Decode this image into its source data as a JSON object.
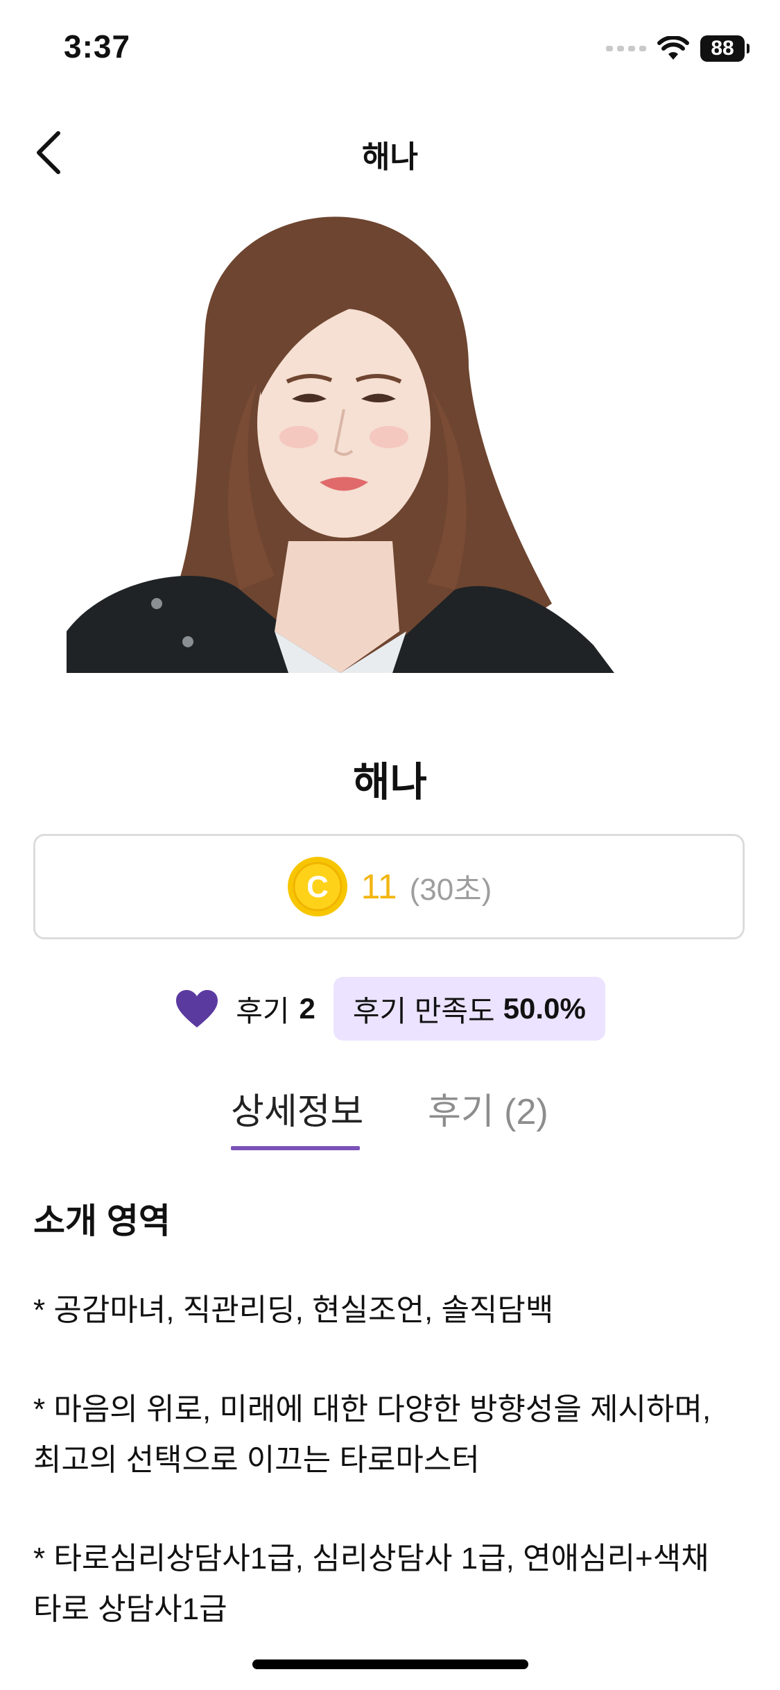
{
  "status_bar": {
    "time": "3:37",
    "battery": "88"
  },
  "nav": {
    "title": "해나"
  },
  "profile": {
    "name": "해나",
    "photo_icon": "profile-photo"
  },
  "price": {
    "coin_icon_letter": "C",
    "amount": "11",
    "unit": "(30초)",
    "coin_color": "#f2b511"
  },
  "stats": {
    "review_label": "후기",
    "review_count": "2",
    "satisfaction_label": "후기 만족도",
    "satisfaction_value": "50.0%",
    "heart_color": "#5b3aa0"
  },
  "tabs": [
    {
      "label": "상세정보",
      "active": true
    },
    {
      "label": "후기 (2)",
      "active": false
    }
  ],
  "accent_color": "#7a52b8",
  "intro": {
    "title": "소개 영역",
    "lines": [
      "* 공감마녀, 직관리딩, 현실조언, 솔직담백",
      "* 마음의 위로, 미래에 대한 다양한 방향성을 제시하며,",
      "최고의 선택으로 이끄는 타로마스터",
      "* 타로심리상담사1급, 심리상담사 1급, 연애심리+색채",
      "타로 상담사1급"
    ]
  }
}
